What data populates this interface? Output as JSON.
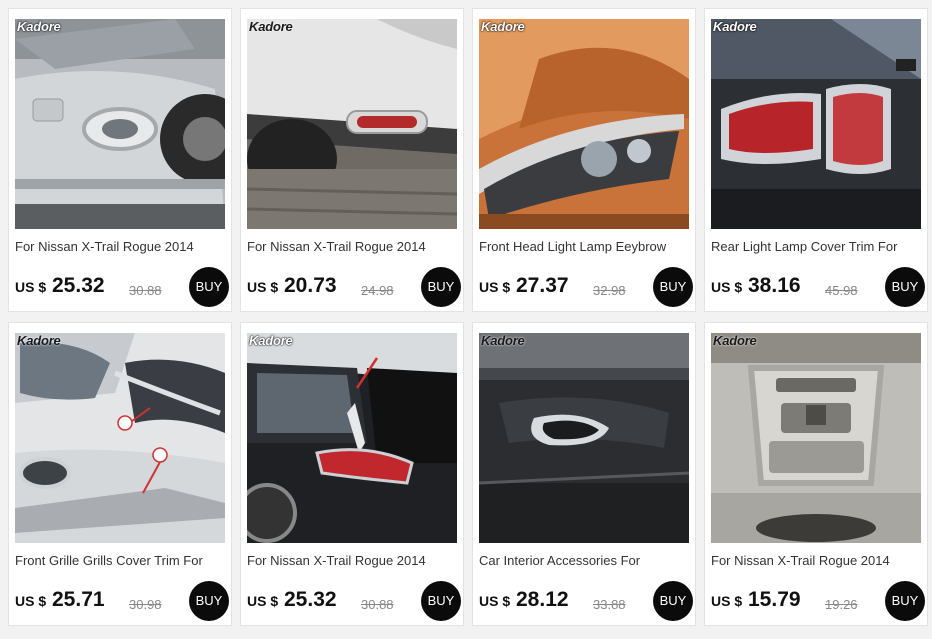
{
  "brand": "Kadore",
  "currency_label": "US $",
  "buy_label": "BUY",
  "products": [
    {
      "title": "For Nissan X-Trail Rogue 2014",
      "price": "25.32",
      "old_price": "30.88"
    },
    {
      "title": "For Nissan X-Trail Rogue 2014",
      "price": "20.73",
      "old_price": "24.98"
    },
    {
      "title": "Front Head Light Lamp Eeybrow",
      "price": "27.37",
      "old_price": "32.98"
    },
    {
      "title": "Rear Light Lamp Cover Trim For",
      "price": "38.16",
      "old_price": "45.98"
    },
    {
      "title": "Front Grille Grills Cover Trim For",
      "price": "25.71",
      "old_price": "30.98"
    },
    {
      "title": "For Nissan X-Trail Rogue 2014",
      "price": "25.32",
      "old_price": "30.88"
    },
    {
      "title": "Car Interior Accessories For",
      "price": "28.12",
      "old_price": "33.88"
    },
    {
      "title": "For Nissan X-Trail Rogue 2014",
      "price": "15.79",
      "old_price": "19.26"
    }
  ]
}
